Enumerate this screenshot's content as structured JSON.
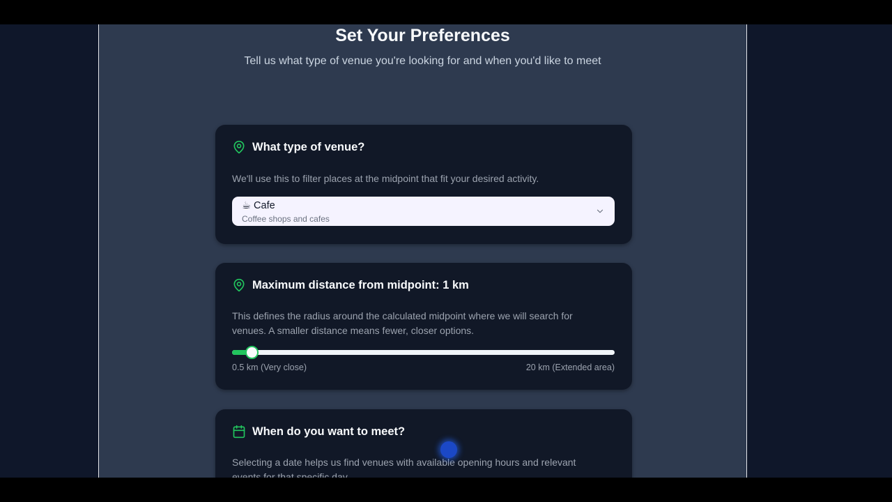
{
  "header": {
    "title": "Set Your Preferences",
    "subtitle": "Tell us what type of venue you're looking for and when you'd like to meet"
  },
  "venue": {
    "title": "What type of venue?",
    "description": "We'll use this to filter places at the midpoint that fit your desired activity.",
    "selected": {
      "emoji": "☕",
      "label": "Cafe",
      "sub": "Coffee shops and cafes"
    }
  },
  "distance": {
    "title": "Maximum distance from midpoint: 1 km",
    "description": "This defines the radius around the calculated midpoint where we will search for venues. A smaller distance means fewer, closer options.",
    "min_label": "0.5 km (Very close)",
    "max_label": "20 km (Extended area)",
    "min": 0.5,
    "max": 20,
    "value": 1
  },
  "date": {
    "title": "When do you want to meet?",
    "description": "Selecting a date helps us find venues with available opening hours and relevant events for that specific day."
  },
  "colors": {
    "accent": "#22c55e",
    "panel": "#2e3a4f",
    "card": "#111827",
    "background": "#0f172a"
  }
}
